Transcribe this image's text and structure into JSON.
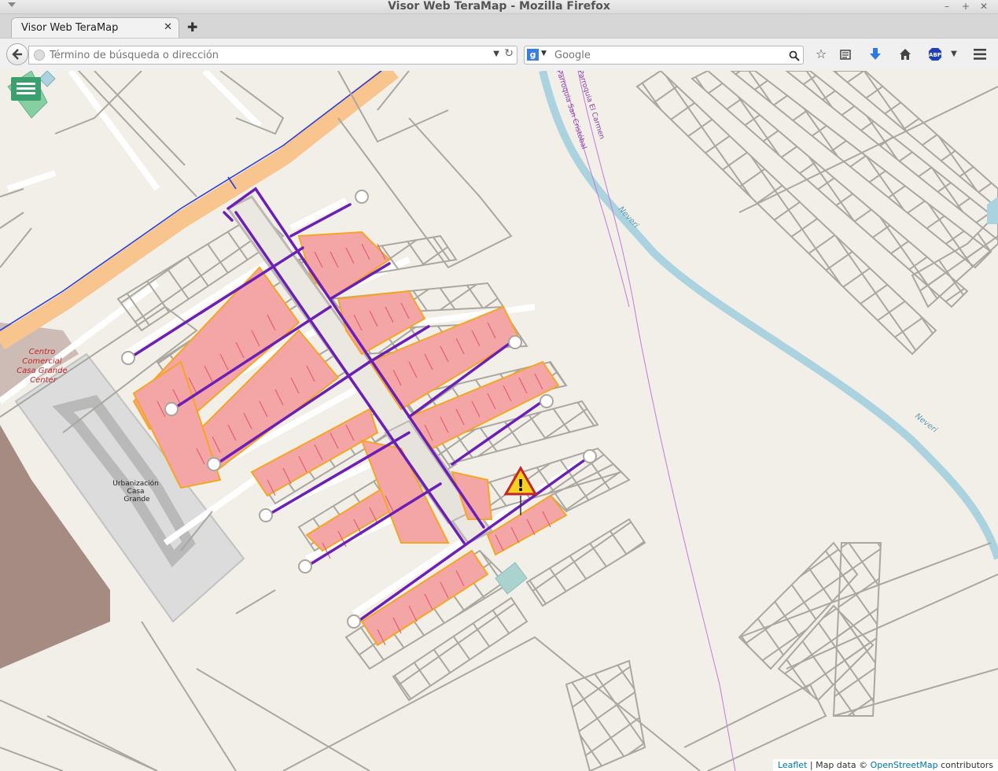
{
  "window": {
    "title": "Visor Web TeraMap - Mozilla Firefox"
  },
  "tab": {
    "label": "Visor Web TeraMap"
  },
  "urlbar": {
    "placeholder": "Término de búsqueda o dirección"
  },
  "searchbar": {
    "engine": "Google",
    "placeholder": "Google"
  },
  "map": {
    "labels": {
      "center_title": [
        "Centro",
        "Comercial",
        "Casa Grande",
        "Center"
      ],
      "urbanizacion": [
        "Urbanización",
        "Casa",
        "Grande"
      ],
      "parroquia_cristobal": "Parroquia San Cristóbal",
      "parroquia_carmen": "Parroquia El Carmen",
      "river1": "Neveri",
      "river2": "Neveri"
    },
    "attribution": {
      "leaflet": "Leaflet",
      "sep": " | Map data © ",
      "osm": "OpenStreetMap",
      "contrib": " contributors"
    },
    "colors": {
      "road": "#f9c58e",
      "water": "#aad3df",
      "lines": "#6b1fb5",
      "highlight": "#f4a5a5",
      "outline": "#f5a623",
      "warning": "#f6d21f"
    }
  }
}
